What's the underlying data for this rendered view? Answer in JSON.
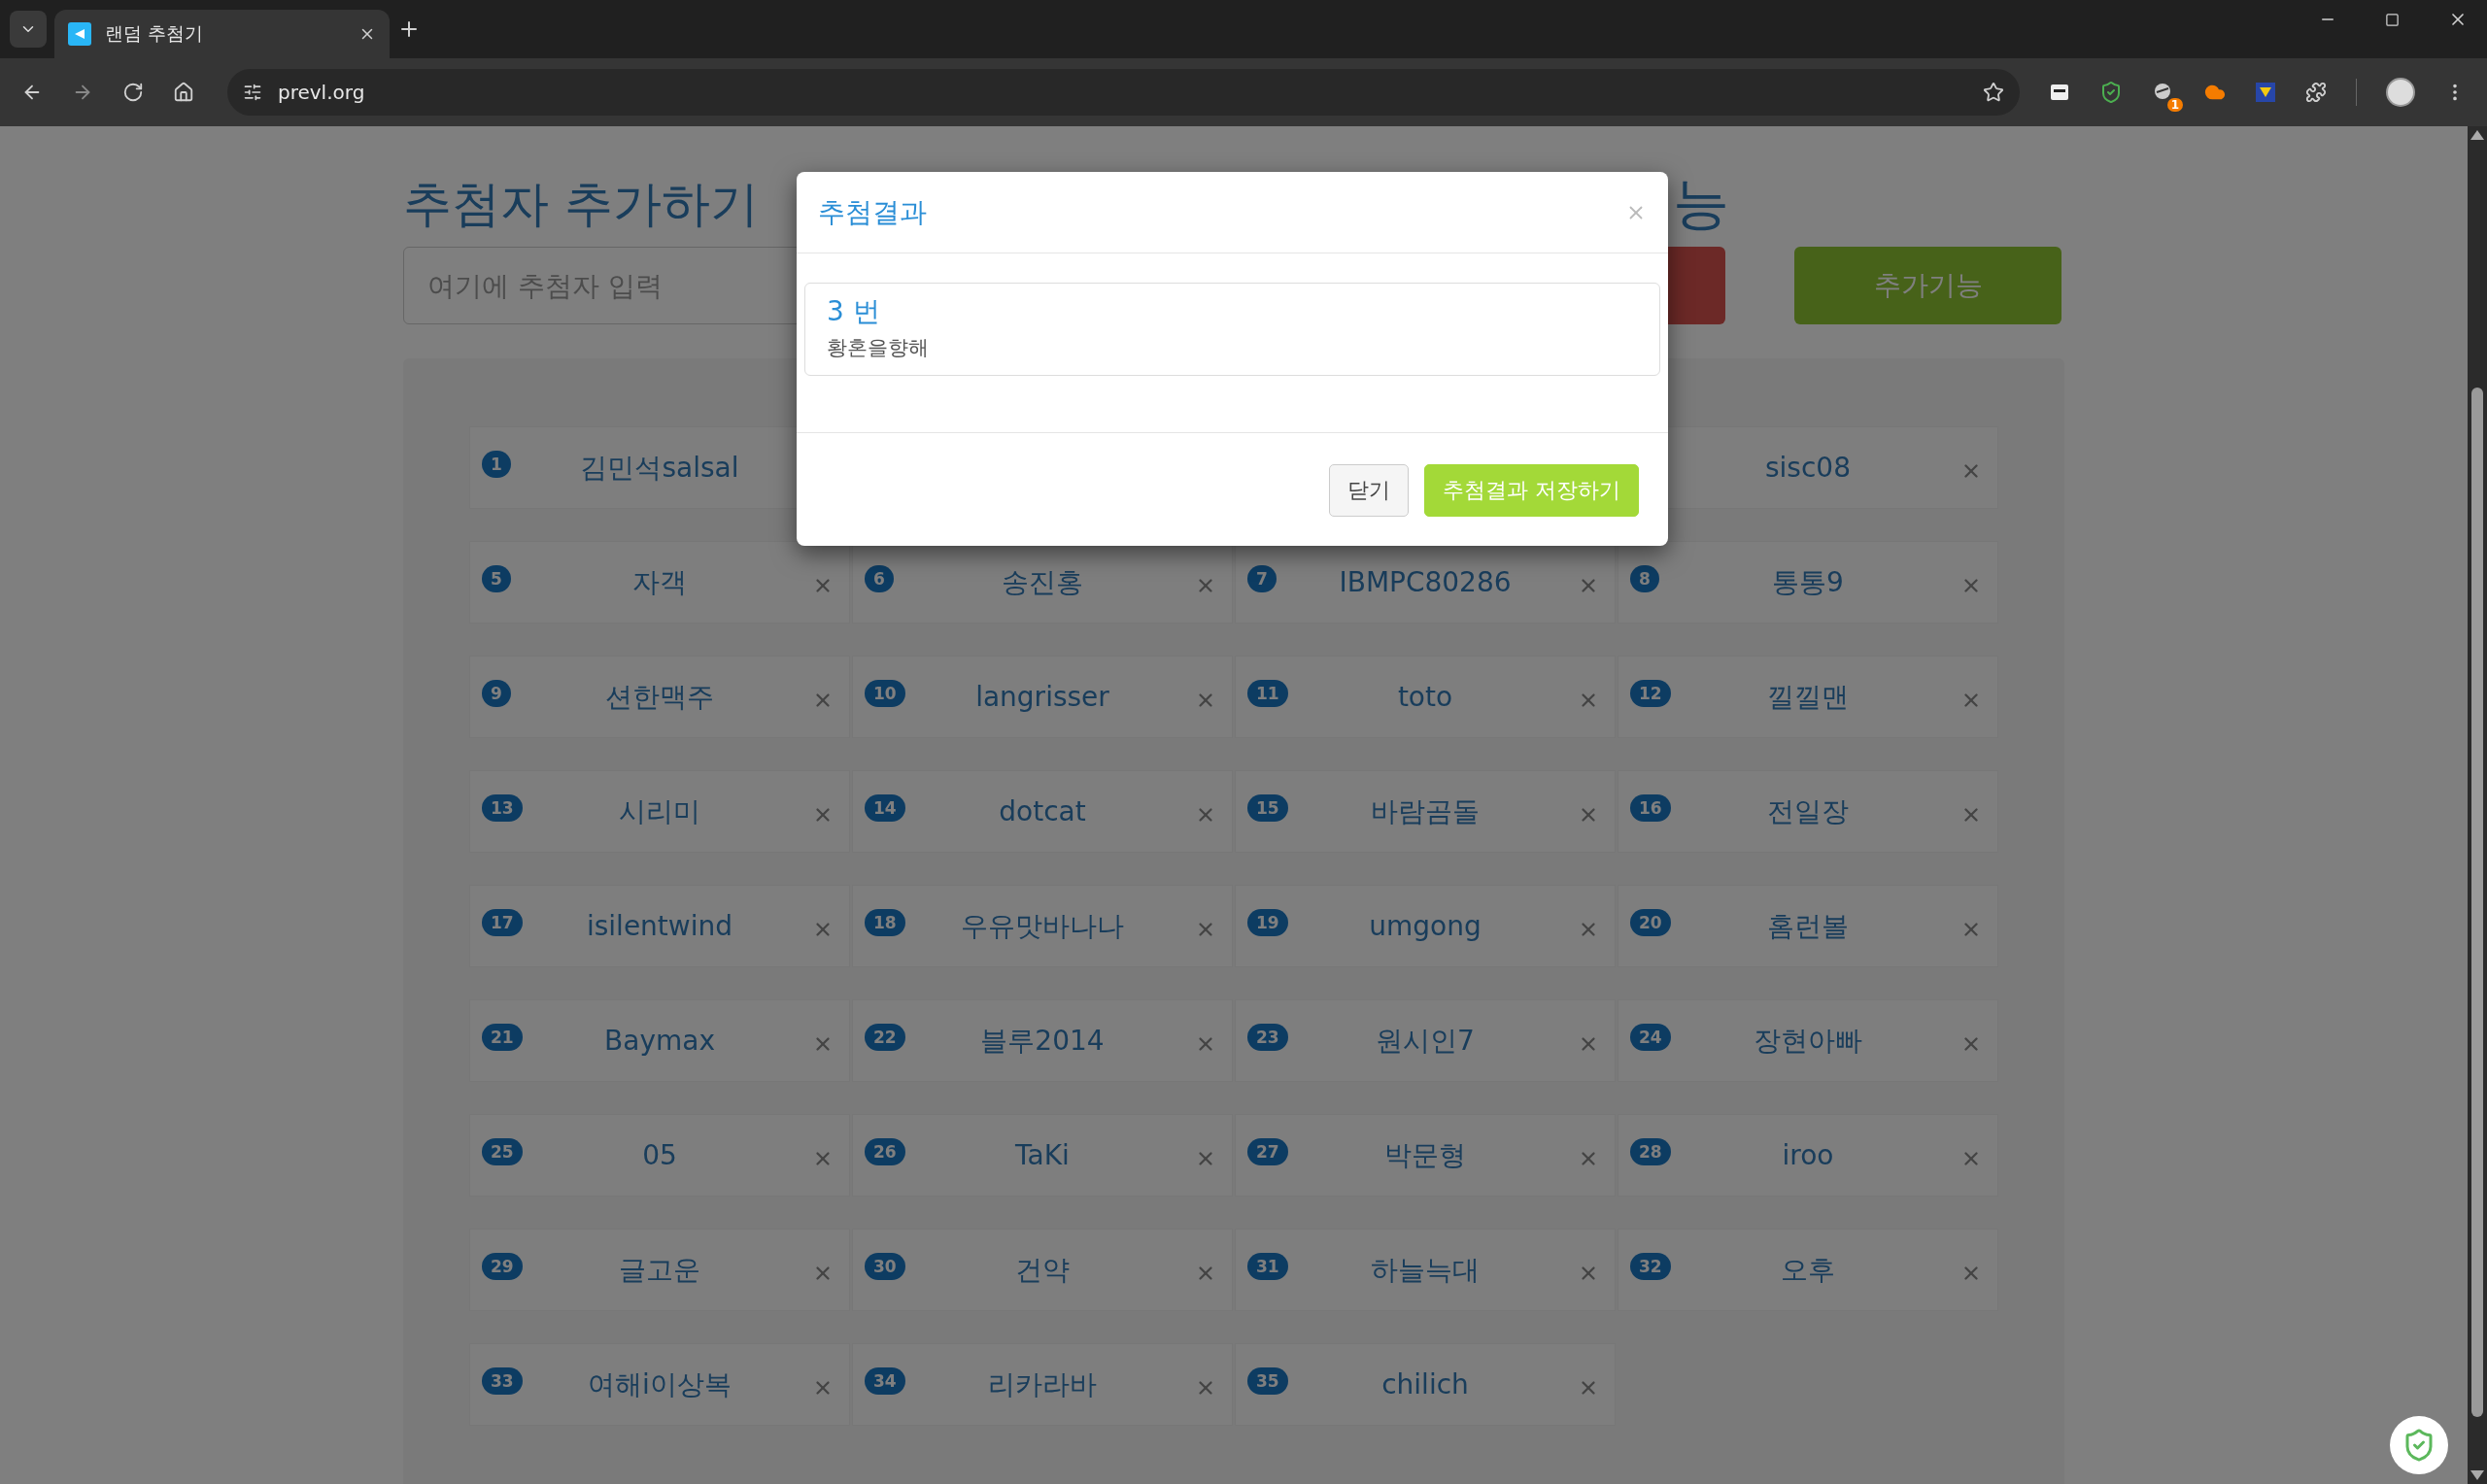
{
  "browser": {
    "tab_title": "랜덤 추첨기",
    "url": "prevl.org",
    "extension_badge": "1"
  },
  "page": {
    "heading": "추첨자 추가하기",
    "heading_right": "능",
    "input": {
      "placeholder": "여기에 추첨자 입력"
    },
    "buttons": [
      {
        "kind": "danger"
      },
      {
        "kind": "success",
        "label": "추가기능"
      }
    ]
  },
  "entries": [
    {
      "kind": "entry_cut",
      "number": "1",
      "name": "김민석salsal"
    },
    {
      "kind": "covered"
    },
    {
      "kind": "covered"
    },
    {
      "kind": "entry",
      "name": "sisc08"
    },
    {
      "kind": "entry",
      "number": "5",
      "name": "자객"
    },
    {
      "kind": "entry",
      "number": "6",
      "name": "송진홍"
    },
    {
      "kind": "entry",
      "number": "7",
      "name": "IBMPC80286"
    },
    {
      "kind": "entry",
      "number": "8",
      "name": "통통9"
    },
    {
      "kind": "entry",
      "number": "9",
      "name": "션한맥주"
    },
    {
      "kind": "entry",
      "number": "10",
      "name": "langrisser"
    },
    {
      "kind": "entry",
      "number": "11",
      "name": "toto"
    },
    {
      "kind": "entry",
      "number": "12",
      "name": "낄낄맨"
    },
    {
      "kind": "entry",
      "number": "13",
      "name": "시리미"
    },
    {
      "kind": "entry",
      "number": "14",
      "name": "dotcat"
    },
    {
      "kind": "entry",
      "number": "15",
      "name": "바람곰돌"
    },
    {
      "kind": "entry",
      "number": "16",
      "name": "전일장"
    },
    {
      "kind": "entry",
      "number": "17",
      "name": "isilentwind"
    },
    {
      "kind": "entry",
      "number": "18",
      "name": "우유맛바나나"
    },
    {
      "kind": "entry",
      "number": "19",
      "name": "umgong"
    },
    {
      "kind": "entry",
      "number": "20",
      "name": "홈런볼"
    },
    {
      "kind": "entry",
      "number": "21",
      "name": "Baymax"
    },
    {
      "kind": "entry",
      "number": "22",
      "name": "블루2014"
    },
    {
      "kind": "entry",
      "number": "23",
      "name": "원시인7"
    },
    {
      "kind": "entry",
      "number": "24",
      "name": "장현아빠"
    },
    {
      "kind": "entry",
      "number": "25",
      "name": "05"
    },
    {
      "kind": "entry",
      "number": "26",
      "name": "TaKi"
    },
    {
      "kind": "entry",
      "number": "27",
      "name": "박문형"
    },
    {
      "kind": "entry",
      "number": "28",
      "name": "iroo"
    },
    {
      "kind": "entry",
      "number": "29",
      "name": "글고운"
    },
    {
      "kind": "entry",
      "number": "30",
      "name": "건약"
    },
    {
      "kind": "entry",
      "number": "31",
      "name": "하늘늑대"
    },
    {
      "kind": "entry",
      "number": "32",
      "name": "오후"
    },
    {
      "kind": "entry",
      "number": "33",
      "name": "여해i이상복"
    },
    {
      "kind": "entry",
      "number": "34",
      "name": "리카라바"
    },
    {
      "kind": "entry",
      "number": "35",
      "name": "chilich"
    }
  ],
  "modal": {
    "title": "추첨결과",
    "result": {
      "number": "3 번",
      "name": "황혼을향해"
    },
    "buttons": [
      {
        "kind": "default",
        "label": "닫기"
      },
      {
        "kind": "primary",
        "label": "추첨결과 저장하기"
      }
    ]
  }
}
